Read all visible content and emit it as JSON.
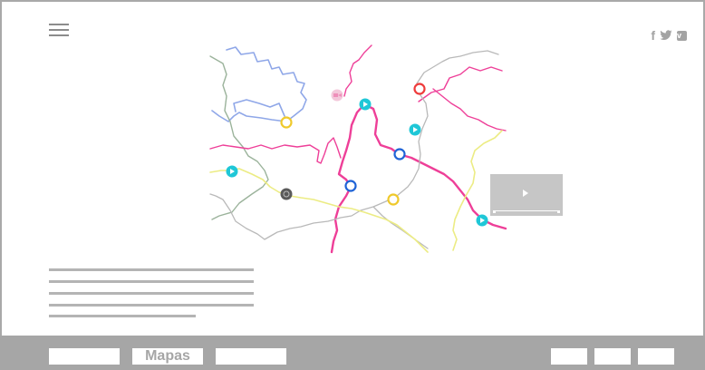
{
  "nav": {
    "menu_icon": "hamburger-menu-icon"
  },
  "social": {
    "facebook": {
      "icon": "facebook-icon",
      "glyph": "f"
    },
    "twitter": {
      "icon": "twitter-icon"
    },
    "vimeo": {
      "icon": "vimeo-icon",
      "glyph": "v"
    }
  },
  "map": {
    "route_colors": {
      "blue": "#8fa7e8",
      "green": "#9bb39b",
      "pink": "#ee3f98",
      "gray": "#b9b9b9",
      "yellow": "#ecec84"
    },
    "marker_colors": {
      "video": "#1fc7d7",
      "yellow": "#efc92b",
      "blue": "#1f63d6",
      "red": "#ee3b3b",
      "dark": "#5a5a5a",
      "camera": "#f3c7da"
    },
    "video_marker_count": 4,
    "yellow_marker_count": 2,
    "blue_marker_count": 2,
    "red_marker_count": 1
  },
  "video_player": {
    "icon": "play-icon"
  },
  "footer": {
    "nav_buttons": [
      "",
      "Mapas",
      ""
    ],
    "right_buttons": [
      "",
      "",
      ""
    ],
    "active": "Mapas"
  }
}
